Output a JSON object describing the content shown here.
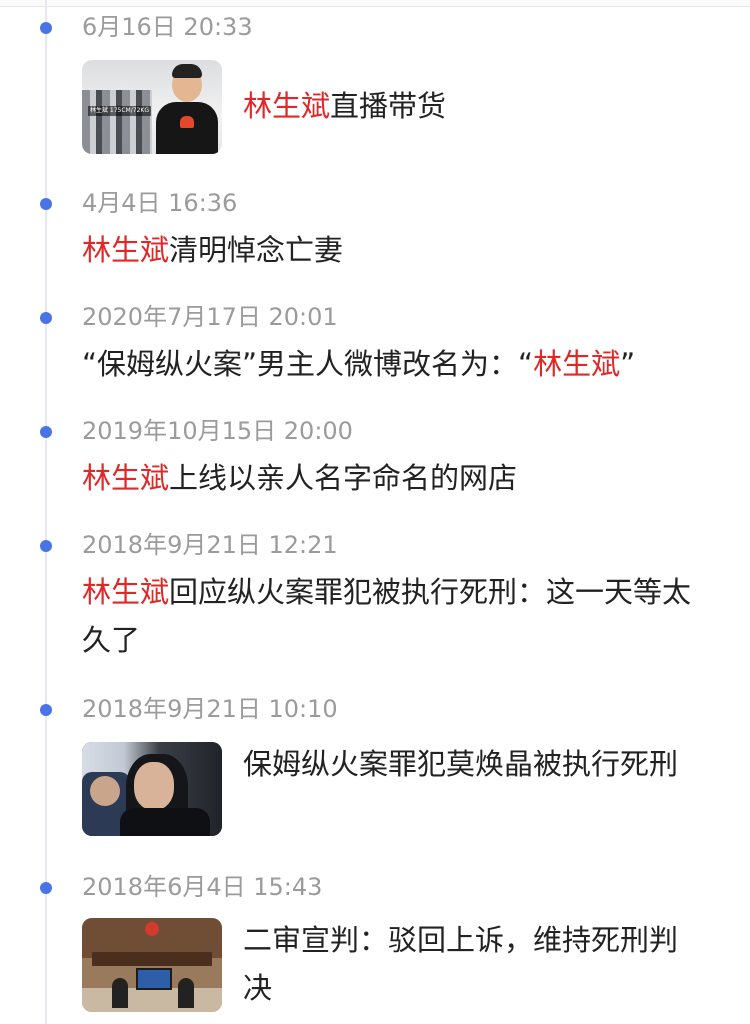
{
  "timeline": [
    {
      "date": "6月16日 20:33",
      "name": "林生斌",
      "text": "直播带货",
      "thumb_icon": "livestream-photo",
      "thumb_label": "林生斌 175CM/72KG"
    },
    {
      "date": "4月4日 16:36",
      "name": "林生斌",
      "text": "清明悼念亡妻"
    },
    {
      "date": "2020年7月17日 20:01",
      "prefix": "“保姆纵火案”男主人微博改名为：“",
      "name": "林生斌",
      "suffix": "”"
    },
    {
      "date": "2019年10月15日 20:00",
      "name": "林生斌",
      "text": "上线以亲人名字命名的网店"
    },
    {
      "date": "2018年9月21日 12:21",
      "name": "林生斌",
      "text": "回应纵火案罪犯被执行死刑：这一天等太久了"
    },
    {
      "date": "2018年9月21日 10:10",
      "text": "保姆纵火案罪犯莫焕晶被执行死刑",
      "thumb_icon": "courtroom-defendant-photo"
    },
    {
      "date": "2018年6月4日 15:43",
      "text": "二审宣判：驳回上诉，维持死刑判决",
      "thumb_icon": "courtroom-hall-photo"
    }
  ],
  "colors": {
    "accent_dot": "#4a74e6",
    "name_highlight": "#e02828",
    "date_text": "#9b9b9b",
    "body_text": "#222222"
  }
}
